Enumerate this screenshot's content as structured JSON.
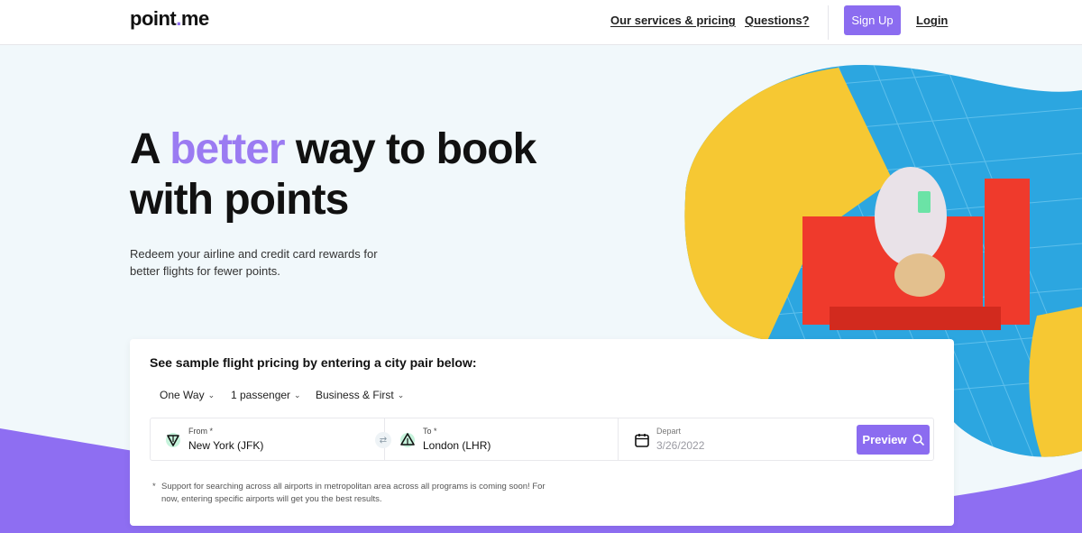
{
  "header": {
    "logo": "point",
    "logo_suffix": "me",
    "nav": {
      "services": "Our services & pricing",
      "questions": "Questions?",
      "signup": "Sign Up",
      "login": "Login"
    }
  },
  "hero": {
    "headline_start": "A ",
    "headline_accent": "better",
    "headline_rest": " way to book with points",
    "subtext": "Redeem your airline and credit card rewards for better flights for fewer points."
  },
  "search": {
    "title": "See sample flight pricing by entering a city pair below:",
    "trip_type": "One Way",
    "passengers": "1 passenger",
    "cabin": "Business & First",
    "from_label": "From *",
    "from_value": "New York (JFK)",
    "to_label": "To *",
    "to_value": "London (LHR)",
    "depart_label": "Depart",
    "depart_placeholder": "3/26/2022",
    "preview_label": "Preview",
    "note": "Support for searching across all airports in metropolitan area across all programs is coming soon! For now, entering specific airports will get you the best results.",
    "note_marker": "*"
  },
  "colors": {
    "accent": "#8b6cf0",
    "hero_bg": "#f1f8fb",
    "purple_wave": "#8e6ef2",
    "pool_blue": "#2ca6e0",
    "yellow": "#f6c833",
    "red_chair": "#ef3a2c"
  },
  "icons": {
    "from": "takeoff-icon",
    "to": "landing-icon",
    "swap": "swap-icon",
    "calendar": "calendar-icon",
    "search": "search-icon"
  }
}
